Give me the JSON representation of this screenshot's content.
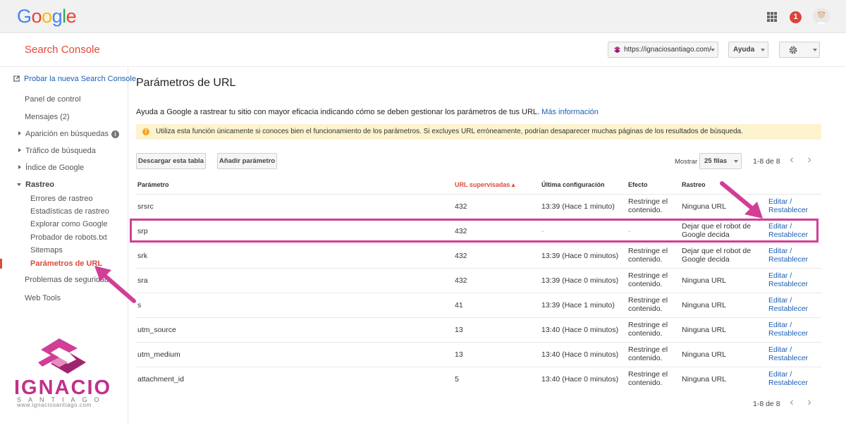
{
  "topbar": {
    "brand_letters": [
      "G",
      "o",
      "o",
      "g",
      "l",
      "e"
    ],
    "brand_colors": [
      "#4285f4",
      "#ea4335",
      "#fbbc05",
      "#4285f4",
      "#34a853",
      "#ea4335"
    ],
    "notification_count": "1"
  },
  "header": {
    "product_title": "Search Console",
    "site_url": "https://ignaciosantiago.com/",
    "help_label": "Ayuda"
  },
  "sidebar": {
    "new_console_link": "Probar la nueva Search Console",
    "items": [
      {
        "label": "Panel de control"
      },
      {
        "label": "Mensajes (2)"
      },
      {
        "label": "Aparición en búsquedas"
      },
      {
        "label": "Tráfico de búsqueda"
      },
      {
        "label": "Índice de Google"
      },
      {
        "label": "Rastreo"
      }
    ],
    "sub_items": [
      {
        "label": "Errores de rastreo"
      },
      {
        "label": "Estadísticas de rastreo"
      },
      {
        "label": "Explorar como Google"
      },
      {
        "label": "Probador de robots.txt"
      },
      {
        "label": "Sitemaps"
      },
      {
        "label": "Parámetros de URL"
      }
    ],
    "after_items": [
      {
        "label": "Problemas de seguridad"
      },
      {
        "label": "Web Tools"
      }
    ]
  },
  "main": {
    "title": "Parámetros de URL",
    "intro_text": "Ayuda a Google a rastrear tu sitio con mayor eficacia indicando cómo se deben gestionar los parámetros de tus URL.",
    "intro_link": "Más información",
    "warning": "Utiliza esta función únicamente si conoces bien el funcionamiento de los parámetros. Si excluyes URL erróneamente, podrían desaparecer muchas páginas de los resultados de búsqueda.",
    "download_button": "Descargar esta tabla",
    "add_param_button": "Añadir parámetro",
    "show_label": "Mostrar",
    "rows_select": "25 filas",
    "pager_text": "1-8 de 8"
  },
  "table": {
    "headers": [
      "Parámetro",
      "URL supervisadas ▴",
      "Última configuración",
      "Efecto",
      "Rastreo"
    ],
    "rows": [
      {
        "param": "srsrc",
        "urls": "432",
        "last": "13:39 (Hace 1 minuto)",
        "effect1": "Restringe el",
        "effect2": "contenido.",
        "crawl1": "Ninguna URL",
        "crawl2": "",
        "edit": "Editar /",
        "reset": "Restablecer"
      },
      {
        "param": "srp",
        "urls": "432",
        "last": "-",
        "effect1": "-",
        "effect2": "",
        "crawl1": "Dejar que el robot de",
        "crawl2": "Google decida",
        "edit": "Editar /",
        "reset": "Restablecer"
      },
      {
        "param": "srk",
        "urls": "432",
        "last": "13:39 (Hace 0 minutos)",
        "effect1": "Restringe el",
        "effect2": "contenido.",
        "crawl1": "Dejar que el robot de",
        "crawl2": "Google decida",
        "edit": "Editar /",
        "reset": "Restablecer"
      },
      {
        "param": "sra",
        "urls": "432",
        "last": "13:39 (Hace 0 minutos)",
        "effect1": "Restringe el",
        "effect2": "contenido.",
        "crawl1": "Ninguna URL",
        "crawl2": "",
        "edit": "Editar /",
        "reset": "Restablecer"
      },
      {
        "param": "s",
        "urls": "41",
        "last": "13:39 (Hace 1 minuto)",
        "effect1": "Restringe el",
        "effect2": "contenido.",
        "crawl1": "Ninguna URL",
        "crawl2": "",
        "edit": "Editar /",
        "reset": "Restablecer"
      },
      {
        "param": "utm_source",
        "urls": "13",
        "last": "13:40 (Hace 0 minutos)",
        "effect1": "Restringe el",
        "effect2": "contenido.",
        "crawl1": "Ninguna URL",
        "crawl2": "",
        "edit": "Editar /",
        "reset": "Restablecer"
      },
      {
        "param": "utm_medium",
        "urls": "13",
        "last": "13:40 (Hace 0 minutos)",
        "effect1": "Restringe el",
        "effect2": "contenido.",
        "crawl1": "Ninguna URL",
        "crawl2": "",
        "edit": "Editar /",
        "reset": "Restablecer"
      },
      {
        "param": "attachment_id",
        "urls": "5",
        "last": "13:40 (Hace 0 minutos)",
        "effect1": "Restringe el",
        "effect2": "contenido.",
        "crawl1": "Ninguna URL",
        "crawl2": "",
        "edit": "Editar /",
        "reset": "Restablecer"
      }
    ]
  },
  "watermark": {
    "word": "IGNACIO",
    "sub": "SANTIAGO",
    "url": "www.ignaciosantiago.com"
  },
  "colors": {
    "accent_red": "#dd4b39",
    "link_blue": "#1a5fb4",
    "highlight_pink": "#d13e96"
  }
}
